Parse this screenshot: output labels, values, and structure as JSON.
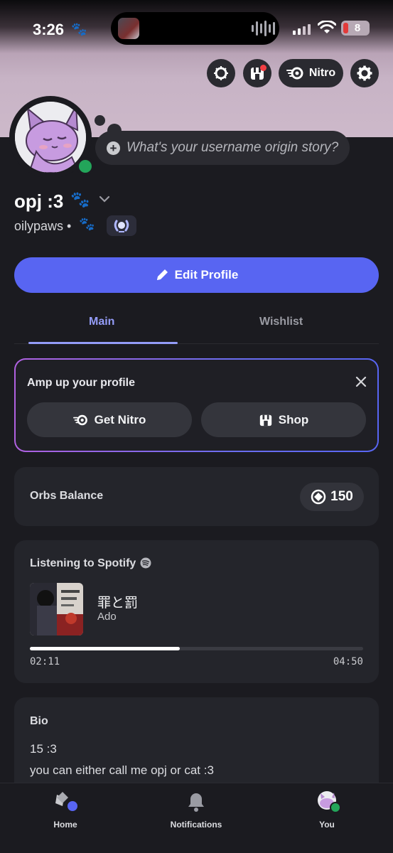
{
  "status_bar": {
    "time": "3:26",
    "battery": "8"
  },
  "header": {
    "nitro_label": "Nitro"
  },
  "profile": {
    "display_name": "opj :3",
    "username": "oilypaws",
    "bubble_prompt": "What's your username origin story?",
    "edit_label": "Edit Profile"
  },
  "tabs": [
    {
      "label": "Main"
    },
    {
      "label": "Wishlist"
    }
  ],
  "amp": {
    "title": "Amp up your profile",
    "get_nitro": "Get Nitro",
    "shop": "Shop"
  },
  "orbs": {
    "label": "Orbs Balance",
    "value": "150"
  },
  "spotify": {
    "label": "Listening to Spotify",
    "track": "罪と罰",
    "artist": "Ado",
    "elapsed": "02:11",
    "duration": "04:50",
    "progress": 0.45
  },
  "bio": {
    "label": "Bio",
    "line1": "15 :3",
    "line2": "you can either call me opj or cat :3"
  },
  "nav": {
    "home": "Home",
    "notifications": "Notifications",
    "you": "You"
  },
  "colors": {
    "accent": "#5865f2",
    "online": "#23a55a",
    "tab_active": "#949cf7"
  }
}
